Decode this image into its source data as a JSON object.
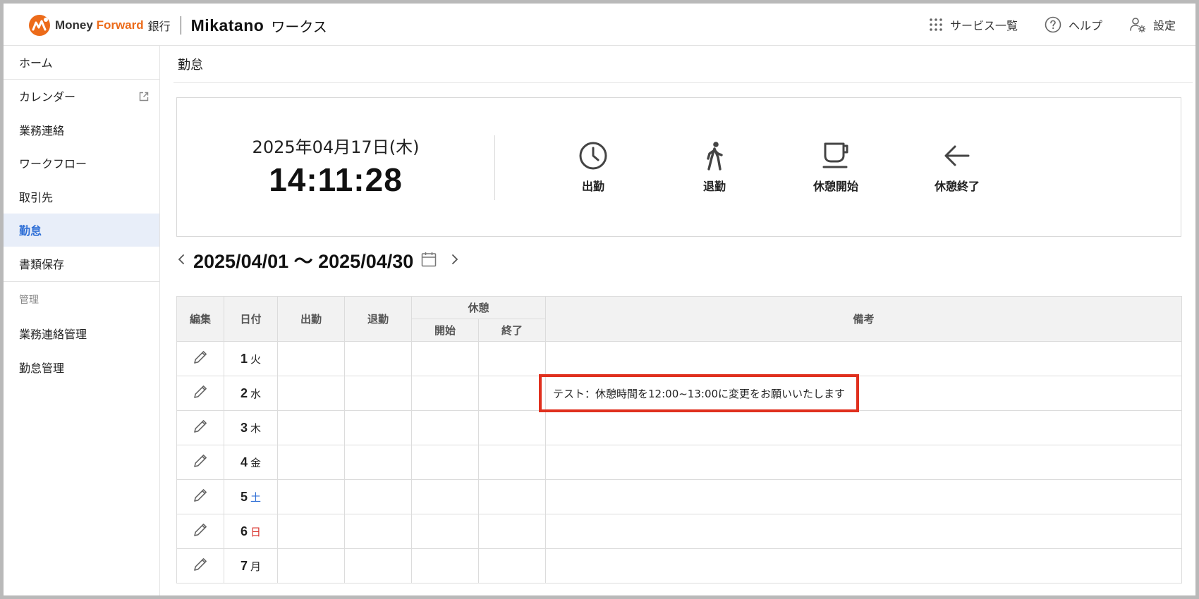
{
  "header": {
    "brand_main": "Money ",
    "brand_accent": "Forward",
    "brand_bank": "銀行",
    "product": "Mikatano",
    "product_suffix": "ワークス",
    "nav": [
      {
        "label": "サービス一覧",
        "icon": "grid-dots-icon"
      },
      {
        "label": "ヘルプ",
        "icon": "help-circle-icon"
      },
      {
        "label": "設定",
        "icon": "user-gear-icon"
      }
    ]
  },
  "sidebar": {
    "items": [
      {
        "label": "ホーム"
      },
      {
        "label": "カレンダー",
        "icon": "external-link-icon"
      },
      {
        "label": "業務連絡"
      },
      {
        "label": "ワークフロー"
      },
      {
        "label": "取引先"
      },
      {
        "label": "勤怠",
        "active": true
      },
      {
        "label": "書類保存"
      }
    ],
    "section_label": "管理",
    "admin_items": [
      {
        "label": "業務連絡管理"
      },
      {
        "label": "勤怠管理"
      }
    ]
  },
  "main": {
    "title": "勤怠",
    "clock": {
      "date": "2025年04月17日(木)",
      "time": "14:11:28"
    },
    "punch_buttons": [
      {
        "label": "出勤",
        "icon": "clock-icon"
      },
      {
        "label": "退勤",
        "icon": "walking-person-icon"
      },
      {
        "label": "休憩開始",
        "icon": "coffee-cup-icon"
      },
      {
        "label": "休憩終了",
        "icon": "arrow-left-icon"
      }
    ],
    "range": "2025/04/01 〜 2025/04/30",
    "table": {
      "headers": {
        "edit": "編集",
        "date": "日付",
        "clock_in": "出勤",
        "clock_out": "退勤",
        "break": "休憩",
        "break_start": "開始",
        "break_end": "終了",
        "remarks": "備考"
      },
      "rows": [
        {
          "day": "1",
          "weekday": "火",
          "remark": ""
        },
        {
          "day": "2",
          "weekday": "水",
          "remark": "テスト：休憩時間を12:00~13:00に変更をお願いいたします"
        },
        {
          "day": "3",
          "weekday": "木",
          "remark": ""
        },
        {
          "day": "4",
          "weekday": "金",
          "remark": ""
        },
        {
          "day": "5",
          "weekday": "土",
          "remark": ""
        },
        {
          "day": "6",
          "weekday": "日",
          "remark": ""
        },
        {
          "day": "7",
          "weekday": "月",
          "remark": ""
        }
      ]
    }
  },
  "colors": {
    "accent": "#2f6fd6",
    "brand_orange": "#ec6b1a",
    "highlight": "#e0301e",
    "sunday": "#d9322b",
    "saturday": "#2f6fd6"
  }
}
